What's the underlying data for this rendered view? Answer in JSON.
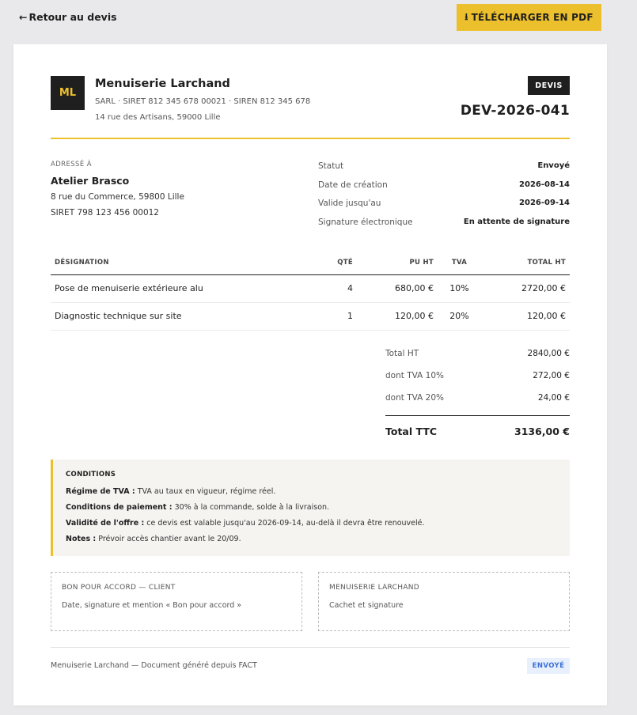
{
  "topbar": {
    "back_icon": "←",
    "back_label": "Retour au devis",
    "pdf_icon": "⭳",
    "pdf_label": "TÉLÉCHARGER EN PDF"
  },
  "company": {
    "logo_initials": "ML",
    "name": "Menuiserie Larchand",
    "legal": "SARL · SIRET 812 345 678 00021 · SIREN 812 345 678",
    "address": "14 rue des Artisans, 59000 Lille"
  },
  "document": {
    "type_badge": "DEVIS",
    "number": "DEV-2026-041"
  },
  "client": {
    "label": "ADRESSÉ À",
    "name": "Atelier Brasco",
    "address": "8 rue du Commerce, 59800 Lille",
    "siret": "SIRET 798 123 456 00012"
  },
  "meta": [
    {
      "key": "Statut",
      "value": "Envoyé"
    },
    {
      "key": "Date de création",
      "value": "2026-08-14"
    },
    {
      "key": "Valide jusqu'au",
      "value": "2026-09-14"
    },
    {
      "key": "Signature électronique",
      "value": "En attente de signature"
    }
  ],
  "table": {
    "headers": {
      "designation": "DÉSIGNATION",
      "qty": "QTÉ",
      "pu": "PU HT",
      "tva": "TVA",
      "total": "TOTAL HT"
    },
    "rows": [
      {
        "designation": "Pose de menuiserie extérieure alu",
        "qty": "4",
        "pu": "680,00 €",
        "tva": "10%",
        "total": "2720,00 €"
      },
      {
        "designation": "Diagnostic technique sur site",
        "qty": "1",
        "pu": "120,00 €",
        "tva": "20%",
        "total": "120,00 €"
      }
    ]
  },
  "totals": {
    "ht_label": "Total HT",
    "ht_value": "2840,00 €",
    "tva10_label": "dont TVA 10%",
    "tva10_value": "272,00 €",
    "tva20_label": "dont TVA 20%",
    "tva20_value": "24,00 €",
    "ttc_label": "Total TTC",
    "ttc_value": "3136,00 €"
  },
  "conditions": {
    "title": "CONDITIONS",
    "lines": [
      {
        "label": "Régime de TVA :",
        "text": " TVA au taux en vigueur, régime réel."
      },
      {
        "label": "Conditions de paiement :",
        "text": " 30% à la commande, solde à la livraison."
      },
      {
        "label": "Validité de l'offre :",
        "text": " ce devis est valable jusqu'au 2026-09-14, au-delà il devra être renouvelé."
      },
      {
        "label": "Notes :",
        "text": " Prévoir accès chantier avant le 20/09."
      }
    ]
  },
  "signatures": {
    "client_title": "BON POUR ACCORD — CLIENT",
    "client_text": "Date, signature et mention « Bon pour accord »",
    "company_title": "MENUISERIE LARCHAND",
    "company_text": "Cachet et signature"
  },
  "footer": {
    "text": "Menuiserie Larchand — Document généré depuis FACT",
    "status": "ENVOYÉ"
  }
}
